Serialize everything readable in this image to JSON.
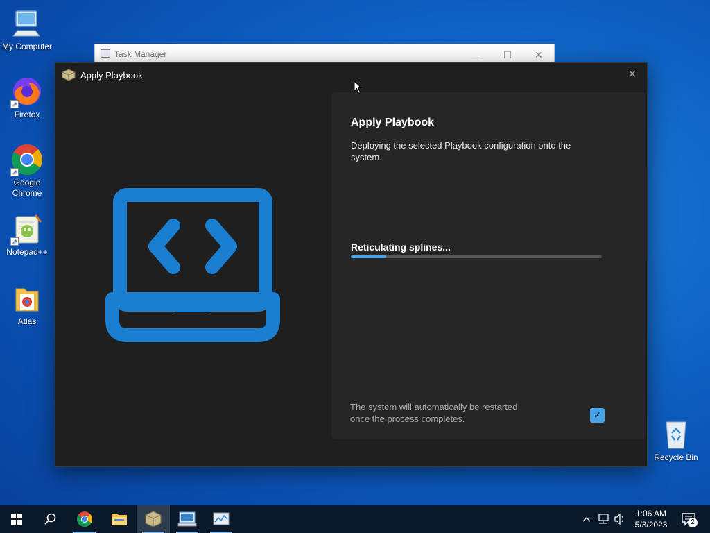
{
  "desktop": {
    "icons": [
      {
        "label": "My Computer"
      },
      {
        "label": "Firefox"
      },
      {
        "label": "Google Chrome"
      },
      {
        "label": "Notepad++"
      },
      {
        "label": "Atlas"
      },
      {
        "label": "Recycle Bin"
      }
    ]
  },
  "task_manager": {
    "title": "Task Manager",
    "minimize": "—",
    "maximize": "☐",
    "close": "✕"
  },
  "apply_window": {
    "title": "Apply Playbook",
    "close": "✕",
    "heading": "Apply Playbook",
    "description": "Deploying the selected Playbook configuration onto the system.",
    "status": "Reticulating splines...",
    "progress_percent": 14,
    "restart_note": "The system will automatically be restarted once the process completes.",
    "restart_checked": true,
    "accent_color": "#4aa3e6",
    "hero_icon": "laptop-code-icon"
  },
  "taskbar": {
    "items": [
      {
        "name": "start-button",
        "icon": "windows-icon"
      },
      {
        "name": "search-button",
        "icon": "search-icon"
      },
      {
        "name": "chrome",
        "icon": "chrome-icon"
      },
      {
        "name": "file-explorer",
        "icon": "folder-icon"
      },
      {
        "name": "apply-playbook",
        "icon": "package-icon",
        "active": true
      },
      {
        "name": "task-manager-1",
        "icon": "monitor-icon"
      },
      {
        "name": "task-manager-2",
        "icon": "task-manager-icon"
      }
    ],
    "clock_time": "1:06 AM",
    "clock_date": "5/3/2023",
    "notification_count": "2"
  }
}
